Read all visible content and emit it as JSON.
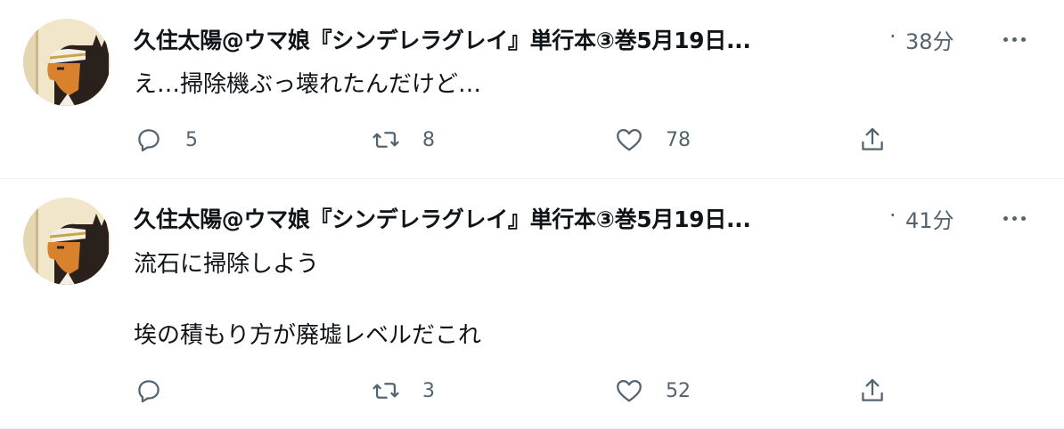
{
  "tweets": [
    {
      "author": "久住太陽@ウマ娘『シンデレラグレイ』単行本③巻5月19日...",
      "separator": "·",
      "time": "38分",
      "text": "え…掃除機ぶっ壊れたんだけど…",
      "replies": "5",
      "retweets": "8",
      "likes": "78"
    },
    {
      "author": "久住太陽@ウマ娘『シンデレラグレイ』単行本③巻5月19日...",
      "separator": "·",
      "time": "41分",
      "text": "流石に掃除しよう\n\n埃の積もり方が廃墟レベルだこれ",
      "replies": "",
      "retweets": "3",
      "likes": "52"
    }
  ],
  "colors": {
    "text": "#0f1419",
    "secondary": "#536471",
    "divider": "#eff3f4"
  },
  "icons": [
    "reply-icon",
    "retweet-icon",
    "like-icon",
    "share-icon",
    "more-icon"
  ]
}
